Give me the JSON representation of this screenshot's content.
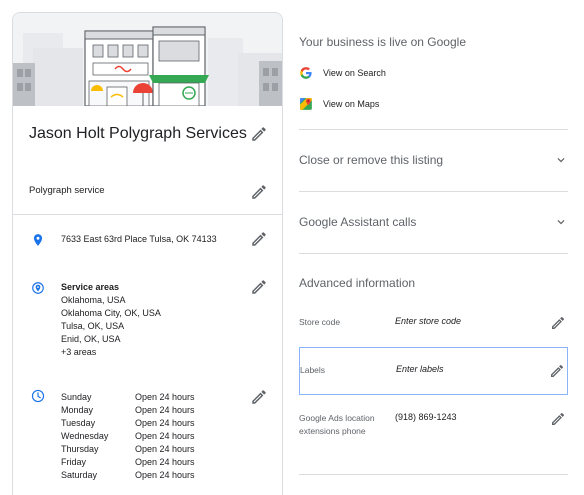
{
  "listing": {
    "name": "Jason Holt Polygraph Services",
    "category": "Polygraph service",
    "address": "7633 East 63rd Place Tulsa, OK 74133",
    "service_areas_title": "Service areas",
    "service_areas": [
      "Oklahoma, USA",
      "Oklahoma City, OK, USA",
      "Tulsa, OK, USA",
      "Enid, OK, USA",
      "+3 areas"
    ],
    "hours": [
      {
        "day": "Sunday",
        "time": "Open 24 hours"
      },
      {
        "day": "Monday",
        "time": "Open 24 hours"
      },
      {
        "day": "Tuesday",
        "time": "Open 24 hours"
      },
      {
        "day": "Wednesday",
        "time": "Open 24 hours"
      },
      {
        "day": "Thursday",
        "time": "Open 24 hours"
      },
      {
        "day": "Friday",
        "time": "Open 24 hours"
      },
      {
        "day": "Saturday",
        "time": "Open 24 hours"
      }
    ]
  },
  "right": {
    "live_title": "Your business is live on Google",
    "view_search": "View on Search",
    "view_maps": "View on Maps",
    "close_listing": "Close or remove this listing",
    "assistant_calls": "Google Assistant calls",
    "advanced_title": "Advanced information",
    "store_code_label": "Store code",
    "store_code_placeholder": "Enter store code",
    "labels_label": "Labels",
    "labels_placeholder": "Enter labels",
    "ads_label": "Google Ads location extensions phone",
    "ads_value": "(918) 869-1243"
  },
  "colors": {
    "accent_blue": "#1a73e8",
    "text_primary": "#202124",
    "text_secondary": "#5f6368",
    "divider": "#dadce0"
  },
  "icons": [
    "edit-pencil-icon",
    "location-pin-icon",
    "clock-icon",
    "google-g-icon",
    "google-maps-icon",
    "chevron-down-icon"
  ]
}
